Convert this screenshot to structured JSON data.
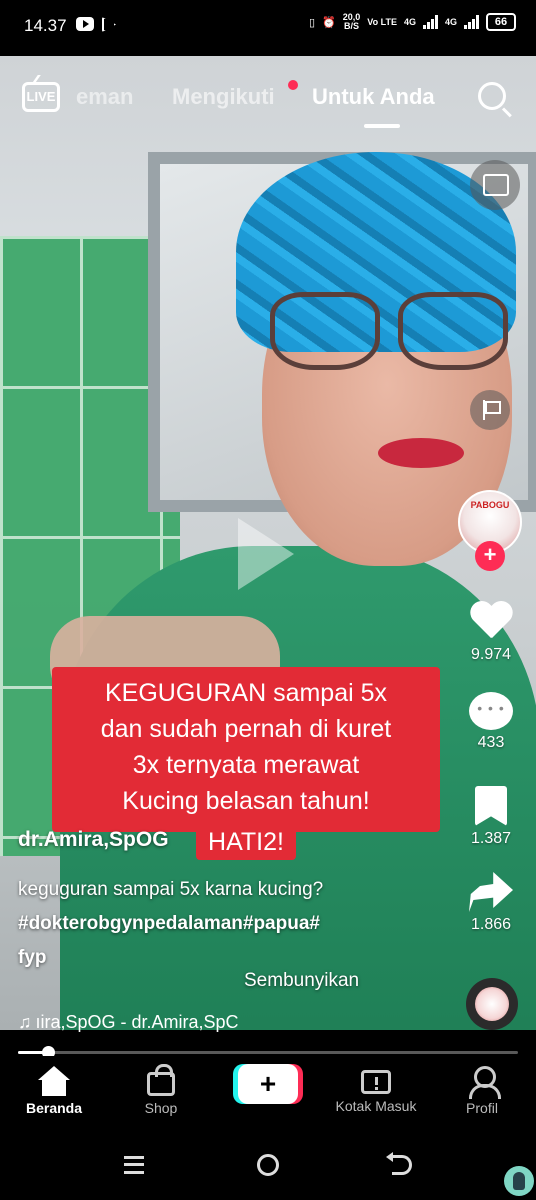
{
  "status_bar": {
    "time": "14.37",
    "network_speed_value": "20,0",
    "network_speed_unit": "B/S",
    "volte_label": "Vo LTE",
    "network_1": "4G",
    "network_2": "4G",
    "battery": "66"
  },
  "top_nav": {
    "live_label": "LIVE",
    "tabs": [
      {
        "label": "Teman",
        "visible_text": "eman"
      },
      {
        "label": "Mengikuti",
        "has_dot": true
      },
      {
        "label": "Untuk Anda",
        "active": true
      }
    ]
  },
  "overlay_caption": {
    "lines": [
      "KEGUGURAN sampai 5x",
      "dan sudah pernah di kuret",
      "3x ternyata merawat",
      "Kucing belasan tahun!"
    ],
    "tail": "HATI2!"
  },
  "avatar_text": "PABOGU",
  "actions": {
    "likes": "9.974",
    "comments": "433",
    "saves": "1.387",
    "shares": "1.866"
  },
  "post": {
    "author": "dr.Amira,SpOG",
    "description": "keguguran sampai 5x karna kucing?",
    "hashtags_line1": "#dokterobgynpedalaman#papua#",
    "hashtags_line2": "fyp",
    "hide_label": "Sembunyikan",
    "sound": "ıira,SpOG - dr.Amira,SpC"
  },
  "progress_fraction": 0.06,
  "bottom_nav": {
    "home": "Beranda",
    "shop": "Shop",
    "create": "+",
    "inbox": "Kotak Masuk",
    "profile": "Profil"
  },
  "colors": {
    "brand_red": "#fe2c55",
    "brand_cyan": "#25f4ee",
    "caption_red": "#e22b36"
  }
}
